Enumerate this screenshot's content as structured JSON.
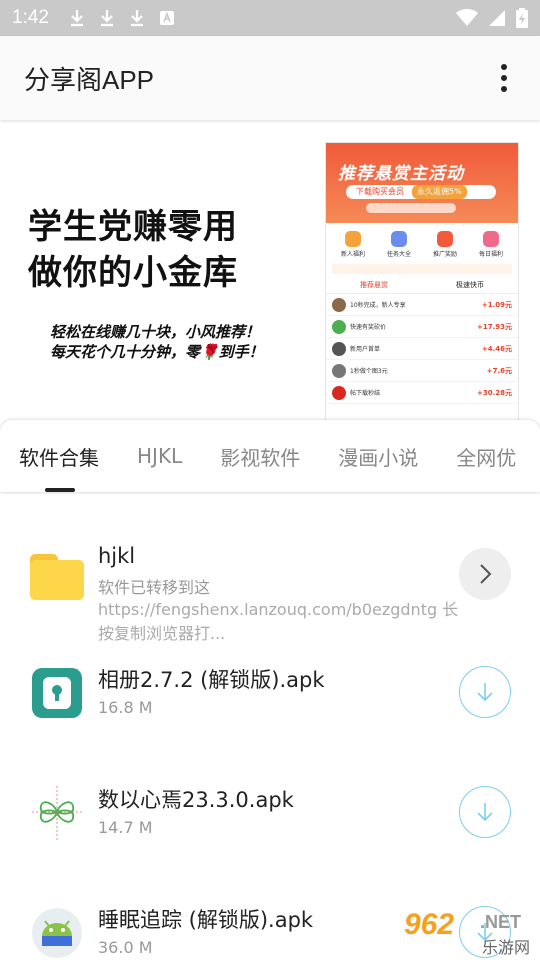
{
  "status_bar": {
    "time": "1:42"
  },
  "app_bar": {
    "title": "分享阁APP",
    "menu_icon": "more-vert-icon"
  },
  "banner": {
    "headline_1": "学生党赚零用",
    "headline_2": "做你的小金库",
    "sub_1": "轻松在线赚几十块，小风推荐！",
    "sub_2": "每天花个几十分钟，零🌹到手！",
    "phone": {
      "headline": "推荐悬赏主活动",
      "pill_text": "下载购买会员",
      "pill_badge": "永久返佣5%",
      "icons": [
        "新人福利",
        "任务大全",
        "推广奖励",
        "每日福利"
      ],
      "tabs": [
        "推荐悬赏",
        "极速快币"
      ],
      "rows": [
        {
          "text": "10秒完成，新人专享",
          "amount": "+1.09元"
        },
        {
          "text": "快速有奖砍价",
          "amount": "+17.93元"
        },
        {
          "text": "新用户首单",
          "amount": "+4.46元"
        },
        {
          "text": "1秒做个图3元",
          "amount": "+7.6元"
        },
        {
          "text": "帖下载秒结",
          "amount": "+30.28元"
        }
      ]
    }
  },
  "tabs": [
    "软件合集",
    "HJKL",
    "影视软件",
    "漫画小说",
    "全网优"
  ],
  "items": [
    {
      "title": "hjkl",
      "subtitle": "软件已转移到这",
      "desc": "https://fengshenx.lanzouq.com/b0ezgdntg 长按复制浏览器打...",
      "icon": "folder-icon",
      "action_icon": "chevron-right-icon"
    },
    {
      "title": "相册2.7.2 (解锁版).apk",
      "size": "16.8 M",
      "icon": "lock-app-icon",
      "action_icon": "download-icon"
    },
    {
      "title": "数以心焉23.3.0.apk",
      "size": "14.7 M",
      "icon": "clover-app-icon",
      "action_icon": "download-icon"
    },
    {
      "title": "睡眠追踪 (解锁版).apk",
      "size": "36.0 M",
      "icon": "android-app-icon",
      "action_icon": "download-icon"
    }
  ],
  "watermark": {
    "brand": "962",
    "net": ".NET",
    "cn": "乐游网"
  },
  "colors": {
    "accent_blue": "#7ccff0",
    "folder_yellow": "#fdd649",
    "banner_red": "#f15a3a",
    "lock_app_teal": "#2a9d8f"
  }
}
